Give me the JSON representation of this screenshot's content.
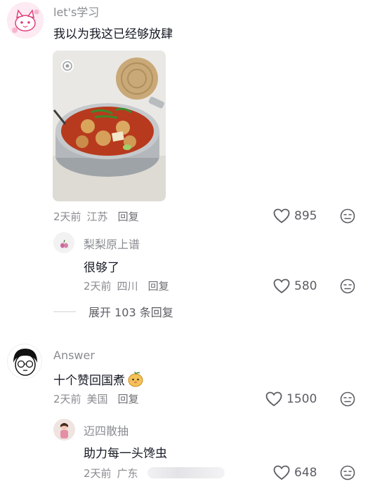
{
  "comments": [
    {
      "user": "let's学习",
      "text": "我以为我这已经够放肆",
      "meta": {
        "time": "2天前",
        "location": "江苏",
        "reply": "回复"
      },
      "likes": "895",
      "replies": [
        {
          "user": "梨梨原上谱",
          "text": "很够了",
          "meta": {
            "time": "2天前",
            "location": "四川",
            "reply": "回复"
          },
          "likes": "580"
        }
      ],
      "expand": "展开 103 条回复"
    },
    {
      "user": "Answer",
      "text": "十个赞回国煮",
      "meta": {
        "time": "2天前",
        "location": "美国",
        "reply": "回复"
      },
      "likes": "1500",
      "replies": [
        {
          "user": "迈四散抽",
          "text": "助力每一头馋虫",
          "meta": {
            "time": "2天前",
            "location": "广东"
          },
          "likes": "648"
        }
      ]
    }
  ],
  "icons": {
    "like": "heart-outline-icon",
    "dislike": "dislike-face-icon"
  },
  "colors": {
    "text": "#161823",
    "secondary": "#8a8b91",
    "icon": "#5c5d63"
  }
}
